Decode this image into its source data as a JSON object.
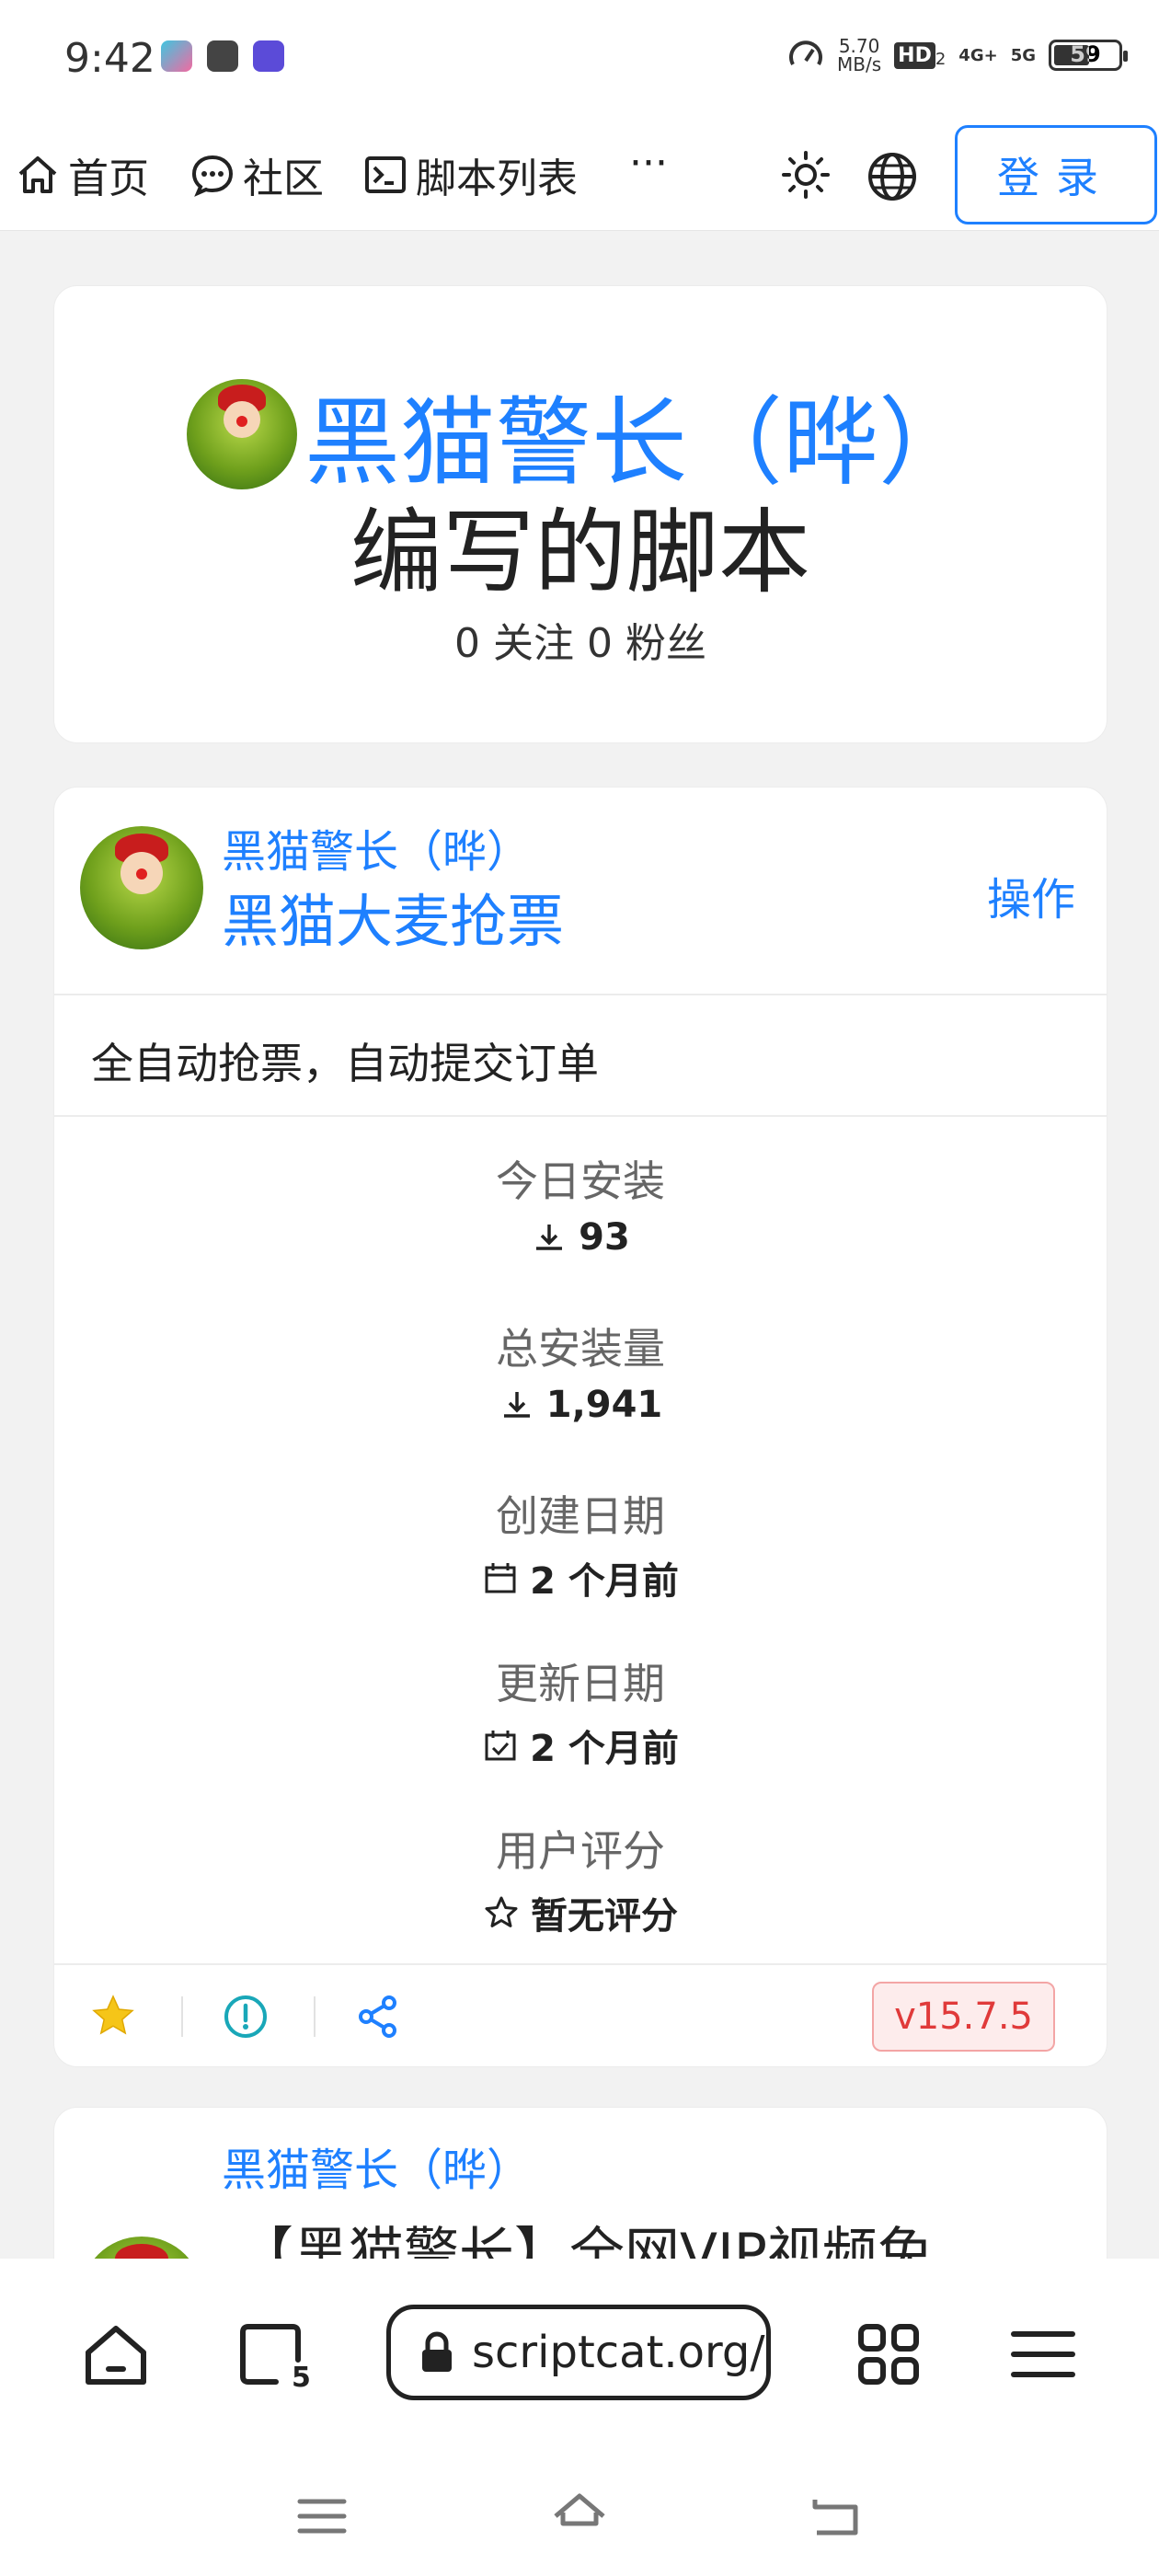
{
  "status_bar": {
    "time": "9:42",
    "speed_value": "5.70",
    "speed_unit": "MB/s",
    "hd_label": "HD",
    "hd_sub": "2",
    "network_4g": "4G+",
    "network_5g": "5G",
    "battery": "59",
    "battery_level": 0.59
  },
  "nav": {
    "home": "首页",
    "community": "社区",
    "scripts": "脚本列表",
    "more": "···",
    "login": "登录"
  },
  "profile": {
    "author": "黑猫警长（晔）",
    "subtitle": "编写的脚本",
    "follow_stats": "0 关注 0 粉丝"
  },
  "script": {
    "author": "黑猫警长（晔）",
    "title": "黑猫大麦抢票",
    "ops": "操作",
    "description": "全自动抢票，自动提交订单",
    "stats": [
      {
        "label": "今日安装",
        "value": "93",
        "icon": "download-icon"
      },
      {
        "label": "总安装量",
        "value": "1,941",
        "icon": "download-icon"
      },
      {
        "label": "创建日期",
        "value": "2 个月前",
        "icon": "calendar-icon"
      },
      {
        "label": "更新日期",
        "value": "2 个月前",
        "icon": "calendar-check-icon"
      },
      {
        "label": "用户评分",
        "value": "暂无评分",
        "icon": "star-outline-icon"
      }
    ],
    "version": "v15.7.5"
  },
  "script2": {
    "author": "黑猫警长（晔）",
    "title": "【黑猫警长】全网VIP视频免"
  },
  "browser": {
    "url": "scriptcat.org/",
    "tab_count": "5"
  },
  "colors": {
    "accent": "#1e80ff",
    "version_red": "#e03a3a",
    "star": "#f5c518",
    "info_teal": "#19a7b8"
  }
}
